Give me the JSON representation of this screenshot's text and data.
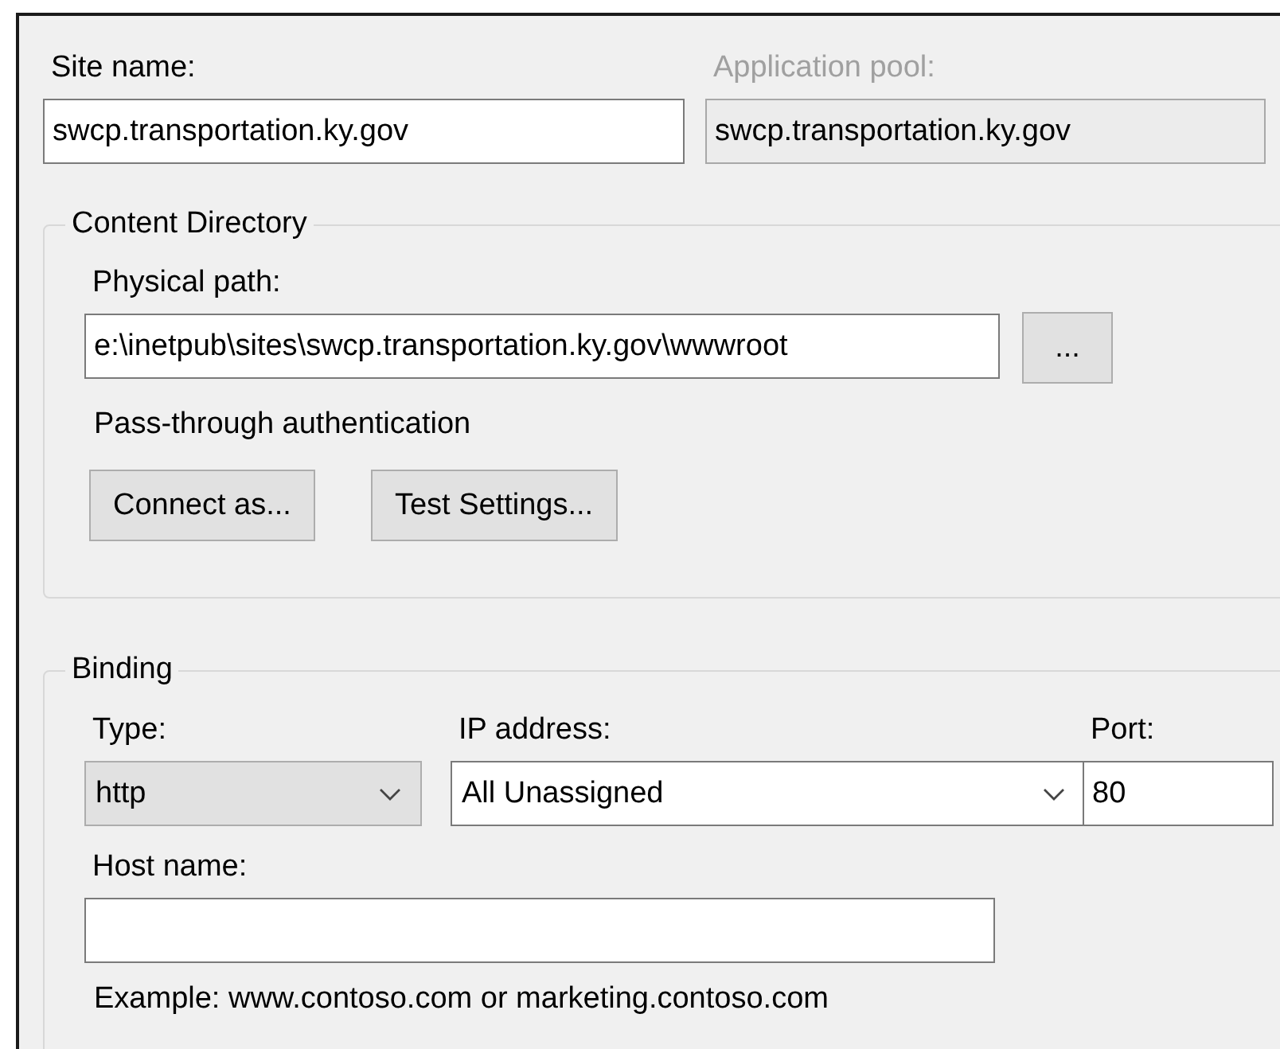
{
  "site_name": {
    "label": "Site name:",
    "value": "swcp.transportation.ky.gov"
  },
  "application_pool": {
    "label": "Application pool:",
    "value": "swcp.transportation.ky.gov",
    "disabled": true
  },
  "content_directory": {
    "title": "Content Directory",
    "physical_path": {
      "label": "Physical path:",
      "value": "e:\\inetpub\\sites\\swcp.transportation.ky.gov\\wwwroot"
    },
    "browse_button": "...",
    "authentication": "Pass-through authentication",
    "buttons": [
      "Connect as...",
      "Test Settings..."
    ]
  },
  "binding": {
    "title": "Binding",
    "type": {
      "label": "Type:",
      "value": "http"
    },
    "ip_address": {
      "label": "IP address:",
      "value": "All Unassigned"
    },
    "port": {
      "label": "Port:",
      "value": "80"
    },
    "host_name": {
      "label": "Host name:"
    },
    "example": "Example: www.contoso.com or marketing.contoso.com"
  }
}
